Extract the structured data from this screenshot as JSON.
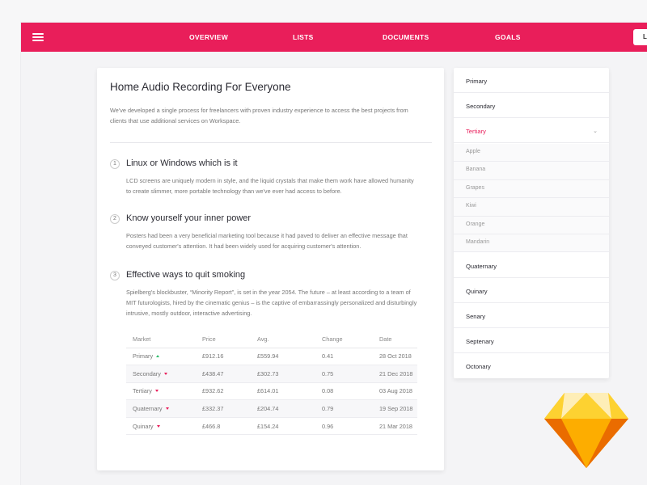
{
  "nav": {
    "items": [
      "OVERVIEW",
      "LISTS",
      "DOCUMENTS",
      "GOALS"
    ],
    "login_label": "Log in",
    "brand_color": "#e91e5a"
  },
  "article": {
    "title": "Home Audio Recording For Everyone",
    "intro": "We've developed a single process for freelancers with proven industry experience to access the best projects from clients that use additional services on Workspace.",
    "steps": [
      {
        "number": "1",
        "title": "Linux or Windows which is it",
        "body": "LCD screens are uniquely modern in style, and the liquid crystals that make them work have allowed humanity to create slimmer, more portable technology than we've ever had access to before."
      },
      {
        "number": "2",
        "title": "Know yourself your inner power",
        "body": "Posters had been a very beneficial marketing tool because it had paved to deliver an effective message that conveyed customer's attention. It had been widely used for acquiring customer's attention."
      },
      {
        "number": "3",
        "title": "Effective ways to quit smoking",
        "body": "Spielberg's blockbuster, “Minority Report”, is set in the year 2054. The future – at least according to a team of MIT futurologists, hired by the cinematic genius – is the captive of embarrassingly personalized and disturbingly intrusive, mostly outdoor, interactive advertising."
      }
    ]
  },
  "table": {
    "headers": [
      "Market",
      "Price",
      "Avg.",
      "Change",
      "Date"
    ],
    "rows": [
      {
        "market": "Primary",
        "trend": "up",
        "price": "£912.16",
        "avg": "£559.94",
        "change": "0.41",
        "date": "28 Oct 2018"
      },
      {
        "market": "Secondary",
        "trend": "down",
        "price": "£438.47",
        "avg": "£302.73",
        "change": "0.75",
        "date": "21 Dec 2018"
      },
      {
        "market": "Tertiary",
        "trend": "down",
        "price": "£932.62",
        "avg": "£614.01",
        "change": "0.08",
        "date": "03 Aug 2018"
      },
      {
        "market": "Quaternary",
        "trend": "down",
        "price": "£332.37",
        "avg": "£204.74",
        "change": "0.79",
        "date": "19 Sep 2018"
      },
      {
        "market": "Quinary",
        "trend": "down",
        "price": "£466.8",
        "avg": "£154.24",
        "change": "0.96",
        "date": "21 Mar 2018"
      }
    ],
    "up_color": "#2ebd6b",
    "down_color": "#e91e5a"
  },
  "sidebar": {
    "items_before": [
      "Primary",
      "Secondary"
    ],
    "active_item": "Tertiary",
    "sub_items": [
      "Apple",
      "Banana",
      "Grapes",
      "Kiwi",
      "Orange",
      "Mandarin"
    ],
    "items_after": [
      "Quaternary",
      "Quinary",
      "Senary",
      "Septenary",
      "Octonary"
    ]
  },
  "icons": {
    "menu": "hamburger-menu-icon",
    "expand": "chevron-down-icon",
    "logo": "sketch-diamond-logo"
  }
}
